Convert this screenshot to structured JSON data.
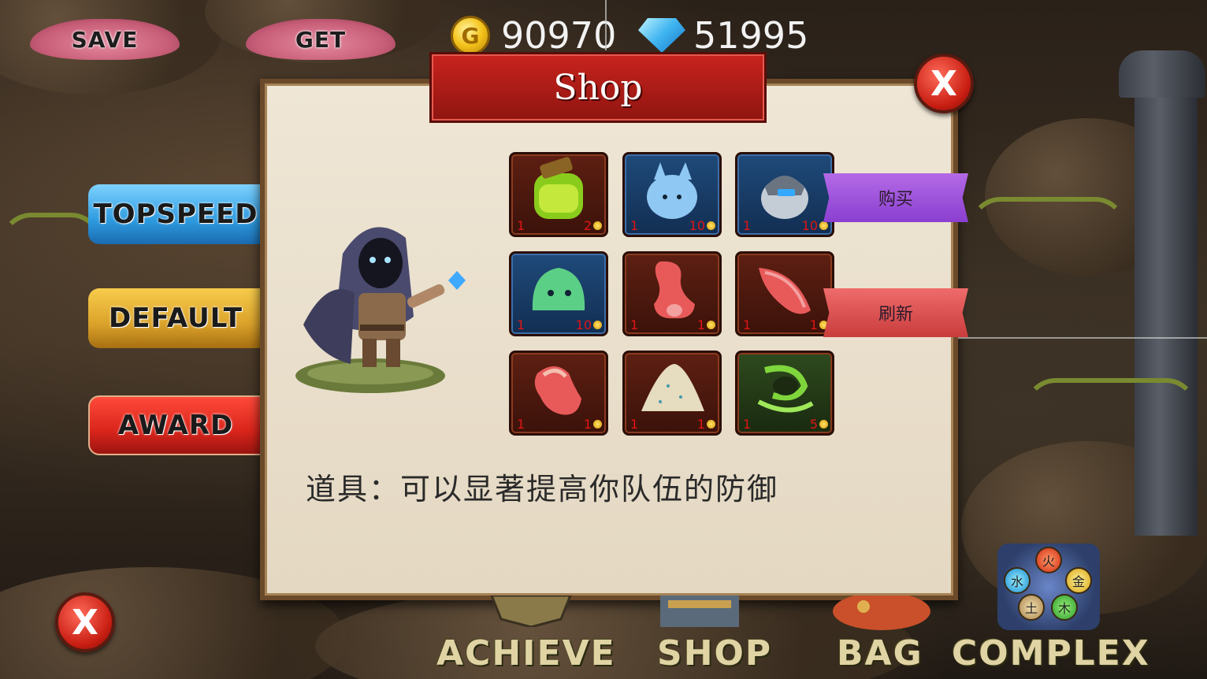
{
  "top_bar": {
    "save_label": "SAVE",
    "get_label": "GET",
    "gold": "90970",
    "gems": "51995"
  },
  "side_menu": {
    "topspeed_label": "TOPSPEED",
    "default_label": "DEFAULT",
    "award_label": "AWARD"
  },
  "close_label": "X",
  "shop": {
    "title": "Shop",
    "buy_label": "购买",
    "refresh_label": "刷新",
    "description": "道具：可以显著提高你队伍的防御",
    "items": [
      {
        "name": "potion-icon",
        "qty": "1",
        "price": "2"
      },
      {
        "name": "blue-slime-icon",
        "qty": "1",
        "price": "10"
      },
      {
        "name": "armored-slime-icon",
        "qty": "1",
        "price": "10"
      },
      {
        "name": "green-slime-icon",
        "qty": "1",
        "price": "10"
      },
      {
        "name": "meat-chunk-icon",
        "qty": "1",
        "price": "1"
      },
      {
        "name": "meat-slice-icon",
        "qty": "1",
        "price": "1"
      },
      {
        "name": "raw-meat-icon",
        "qty": "1",
        "price": "1"
      },
      {
        "name": "salt-pile-icon",
        "qty": "1",
        "price": "1"
      },
      {
        "name": "wind-skill-icon",
        "qty": "1",
        "price": "5"
      }
    ]
  },
  "bottom_nav": {
    "achieve_label": "ACHIEVE",
    "shop_label": "SHOP",
    "bag_label": "BAG",
    "complex_label": "COMPLEX"
  },
  "elements": {
    "fire": "火",
    "water": "水",
    "metal": "金",
    "earth": "土",
    "wood": "木"
  },
  "colors": {
    "accent_red": "#c9231d",
    "buy_purple": "#8a3fd0",
    "refresh_red": "#c93c3c",
    "price_red": "#e21414"
  }
}
